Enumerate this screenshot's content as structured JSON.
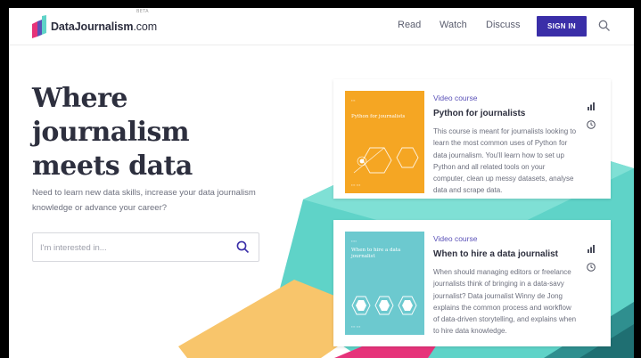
{
  "header": {
    "logo_bold": "DataJournalism",
    "logo_suffix": ".com",
    "logo_beta": "BETA",
    "nav": [
      "Read",
      "Watch",
      "Discuss"
    ],
    "signin_label": "SIGN IN"
  },
  "hero": {
    "title_lines": [
      "Where",
      "journalism",
      "meets data"
    ],
    "subtitle": "Need to learn new data skills, increase your data journalism knowledge or advance your career?",
    "search_placeholder": "I'm interested in..."
  },
  "cards": [
    {
      "kind": "Video course",
      "title": "Python for journalists",
      "description": "This course is meant for journalists looking to learn the most common uses of Python for data journalism. You'll learn how to set up Python and all related tools on your computer, clean up messy datasets, analyse data and scrape data.",
      "thumb_title": "Python for journalists",
      "thumb_color": "#f5a623",
      "icons": [
        "level-bars-icon",
        "clock-icon"
      ]
    },
    {
      "kind": "Video course",
      "title": "When to hire a data journalist",
      "description": "When should managing editors or freelance journalists think of bringing in a data-savy journalist? Data journalist Winny de Jong explains the common process and workflow of data-driven storytelling, and explains when to hire data knowledge.",
      "thumb_title": "When to hire a data journalist",
      "thumb_color": "#6cc9cf",
      "icons": [
        "level-bars-icon",
        "clock-icon"
      ]
    }
  ],
  "colors": {
    "accent": "#3a2ea8",
    "teal": "#5fd3c8",
    "yellow": "#f8c56b",
    "pink": "#e6337a",
    "dark_teal": "#2f8f8f"
  }
}
